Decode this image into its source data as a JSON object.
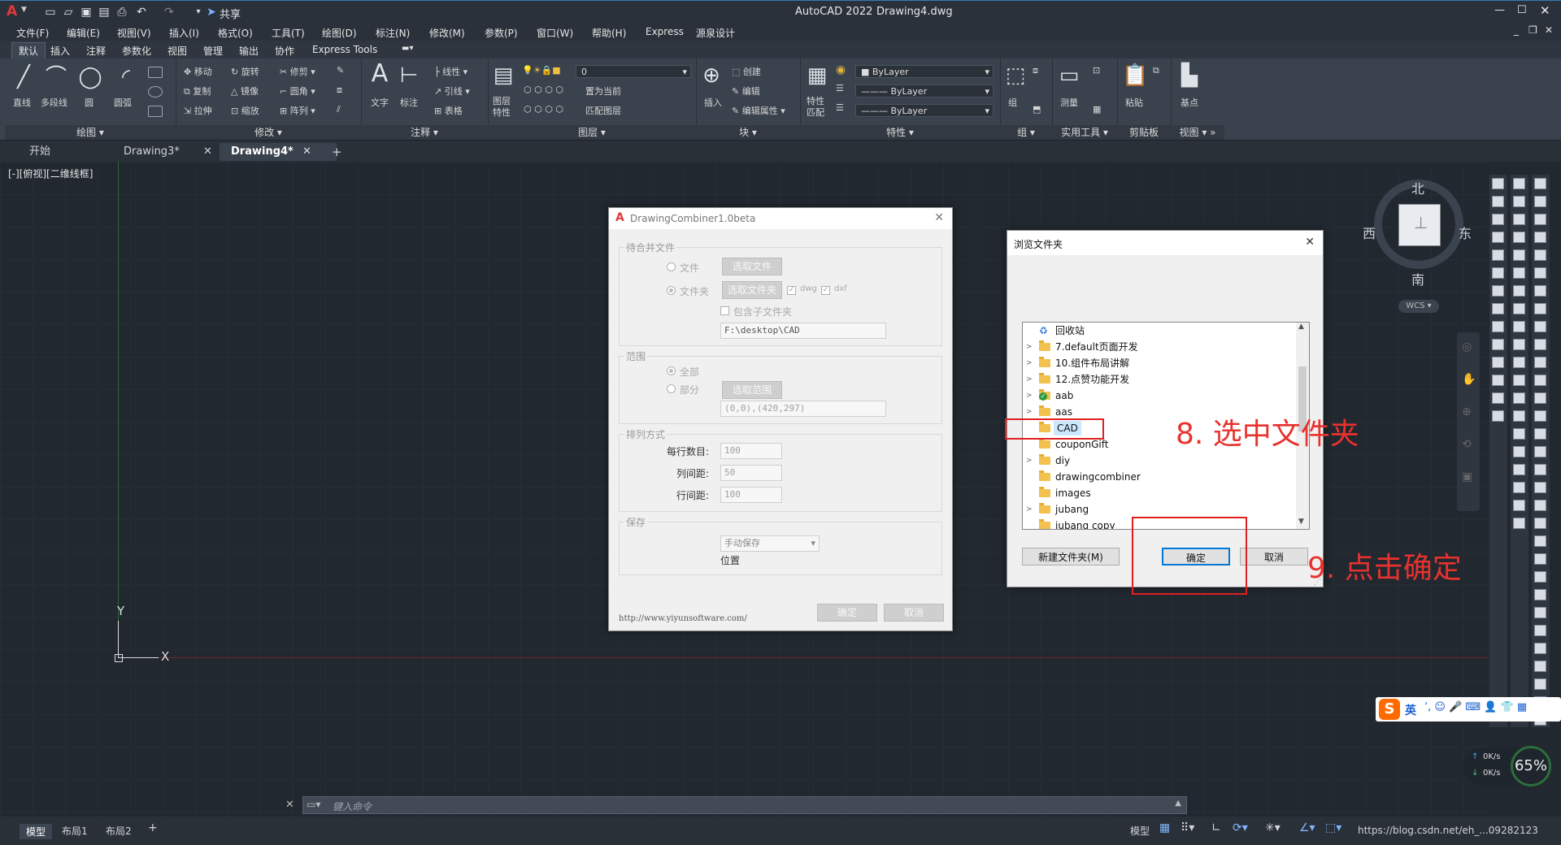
{
  "app": {
    "title": "AutoCAD 2022",
    "document": "Drawing4.dwg",
    "share_label": "共享"
  },
  "menu": [
    "文件(F)",
    "编辑(E)",
    "视图(V)",
    "插入(I)",
    "格式(O)",
    "工具(T)",
    "绘图(D)",
    "标注(N)",
    "修改(M)",
    "参数(P)",
    "窗口(W)",
    "帮助(H)",
    "Express",
    "源泉设计"
  ],
  "ribbon_tabs": [
    "默认",
    "插入",
    "注释",
    "参数化",
    "视图",
    "管理",
    "输出",
    "协作",
    "Express Tools"
  ],
  "ribbon": {
    "draw": {
      "title": "绘图",
      "line": "直线",
      "polyline": "多段线",
      "circle": "圆",
      "arc": "圆弧"
    },
    "modify": {
      "title": "修改",
      "move": "移动",
      "rotate": "旋转",
      "trim": "修剪",
      "copy": "复制",
      "mirror": "镜像",
      "fillet": "圆角",
      "stretch": "拉伸",
      "scale": "缩放",
      "array": "阵列"
    },
    "annotation": {
      "title": "注释",
      "text": "文字",
      "dimension": "标注",
      "linear": "线性",
      "leader": "引线",
      "table": "表格"
    },
    "layers": {
      "title": "图层",
      "props": "图层特性",
      "current_layer": "0",
      "set_current": "置为当前",
      "match": "匹配图层"
    },
    "block": {
      "title": "块",
      "insert": "插入",
      "create": "创建",
      "edit": "编辑",
      "edit_attr": "编辑属性"
    },
    "properties": {
      "title": "特性",
      "match": "特性匹配",
      "bylayer1": "ByLayer",
      "bylayer2": "ByLayer",
      "bylayer3": "ByLayer"
    },
    "groups": {
      "title": "组",
      "group": "组"
    },
    "utilities": {
      "title": "实用工具",
      "measure": "测量"
    },
    "clipboard": {
      "title": "剪贴板",
      "paste": "粘贴"
    },
    "view": {
      "title": "视图",
      "base": "基点"
    }
  },
  "doc_tabs": [
    {
      "label": "开始"
    },
    {
      "label": "Drawing3*"
    },
    {
      "label": "Drawing4*"
    }
  ],
  "viewport_label": "[-][俯视][二维线框]",
  "viewcube": {
    "north": "北",
    "south": "南",
    "west": "西",
    "east": "东",
    "wcs": "WCS"
  },
  "ucs": {
    "x": "X",
    "y": "Y"
  },
  "combiner_dialog": {
    "title": "DrawingCombiner1.0beta",
    "group_files": "待合并文件",
    "opt_file": "文件",
    "btn_select_file": "选取文件",
    "opt_folder": "文件夹",
    "btn_select_folder": "选取文件夹",
    "dwg": "dwg",
    "dxf": "dxf",
    "include_sub": "包含子文件夹",
    "path": "F:\\desktop\\CAD",
    "group_range": "范围",
    "opt_all": "全部",
    "opt_part": "部分",
    "btn_select_range": "选取范围",
    "range_value": "(0,0),(420,297)",
    "group_arrange": "排列方式",
    "per_row_label": "每行数目:",
    "per_row": "100",
    "col_gap_label": "列间距:",
    "col_gap": "50",
    "row_gap_label": "行间距:",
    "row_gap": "100",
    "group_save": "保存",
    "save_mode": "手动保存",
    "location": "位置",
    "url": "http://www.yiyunsoftware.com/",
    "ok": "确定",
    "cancel": "取消"
  },
  "browse_dialog": {
    "title": "浏览文件夹",
    "items": [
      {
        "label": "回收站",
        "expand": ""
      },
      {
        "label": "7.default页面开发",
        "expand": ">"
      },
      {
        "label": "10.组件布局讲解",
        "expand": ">"
      },
      {
        "label": "12.点赞功能开发",
        "expand": ">"
      },
      {
        "label": "aab",
        "expand": ">"
      },
      {
        "label": "aas",
        "expand": ">"
      },
      {
        "label": "CAD",
        "expand": ""
      },
      {
        "label": "couponGift",
        "expand": ""
      },
      {
        "label": "diy",
        "expand": ">"
      },
      {
        "label": "drawingcombiner",
        "expand": ""
      },
      {
        "label": "images",
        "expand": ""
      },
      {
        "label": "jubang",
        "expand": ">"
      },
      {
        "label": "jubang copy",
        "expand": ""
      }
    ],
    "new_folder": "新建文件夹(M)",
    "ok": "确定",
    "cancel": "取消"
  },
  "annotations": {
    "step8": "8. 选中文件夹",
    "step9": "9. 点击确定"
  },
  "command_placeholder": "键入命令",
  "layout_tabs": [
    "模型",
    "布局1",
    "布局2"
  ],
  "status": {
    "model": "模型",
    "zoom": "65%",
    "net_up": "0K/s",
    "net_down": "0K/s",
    "ime": "英",
    "watermark": "https://blog.csdn.net/eh_...09282123"
  },
  "colors": {
    "accent": "#3b76b9",
    "annotation": "#e8322e",
    "canvas": "#212830"
  }
}
